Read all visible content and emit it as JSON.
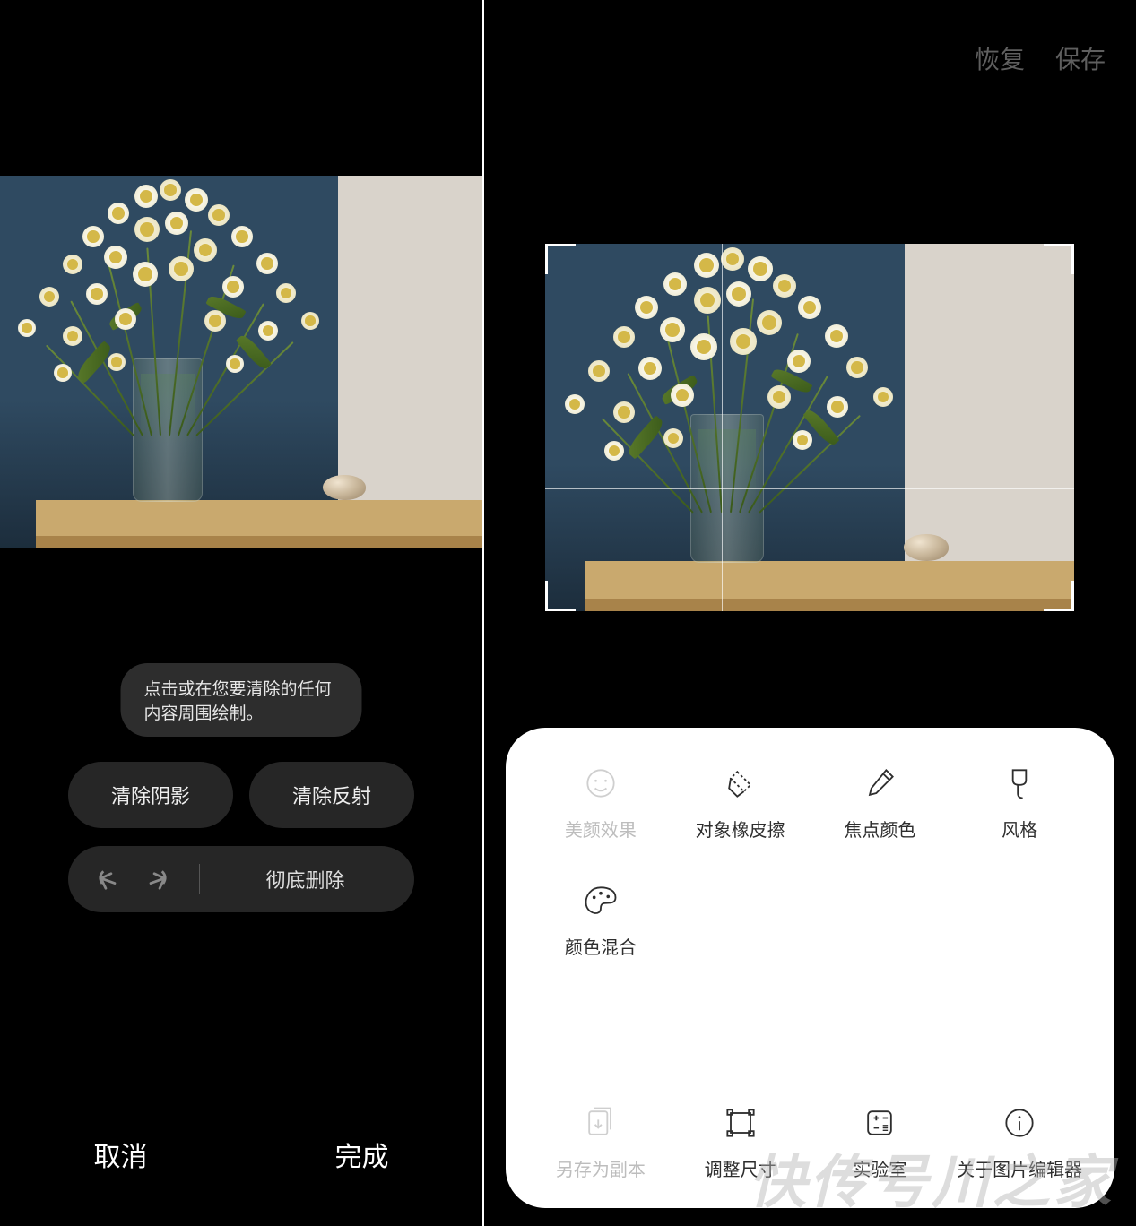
{
  "left": {
    "hint": "点击或在您要清除的任何内容周围绘制。",
    "clear_shadow": "清除阴影",
    "clear_reflection": "清除反射",
    "delete_all": "彻底删除",
    "cancel": "取消",
    "done": "完成"
  },
  "right": {
    "restore": "恢复",
    "save": "保存",
    "tools": {
      "beauty": "美颜效果",
      "eraser": "对象橡皮擦",
      "spot_color": "焦点颜色",
      "style": "风格",
      "color_mix": "颜色混合"
    },
    "bottom": {
      "save_copy": "另存为副本",
      "resize": "调整尺寸",
      "lab": "实验室",
      "about": "关于图片编辑器"
    }
  },
  "watermark": "快传号川之家"
}
